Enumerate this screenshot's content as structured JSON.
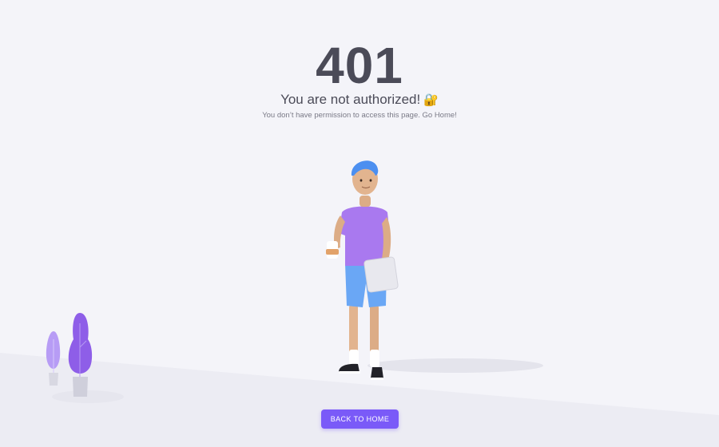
{
  "error": {
    "code": "401",
    "title": "You are not authorized!",
    "title_emoji": "🔐",
    "message": "You don’t have permission to access this page. Go Home!"
  },
  "button": {
    "label": "BACK TO HOME"
  },
  "colors": {
    "background": "#f4f4f9",
    "text": "#4b4b58",
    "muted": "#7a7a87",
    "accent": "#7a5af8"
  },
  "illustration": {
    "character": "person-with-coffee-and-laptop",
    "decoration": "purple-plants"
  }
}
